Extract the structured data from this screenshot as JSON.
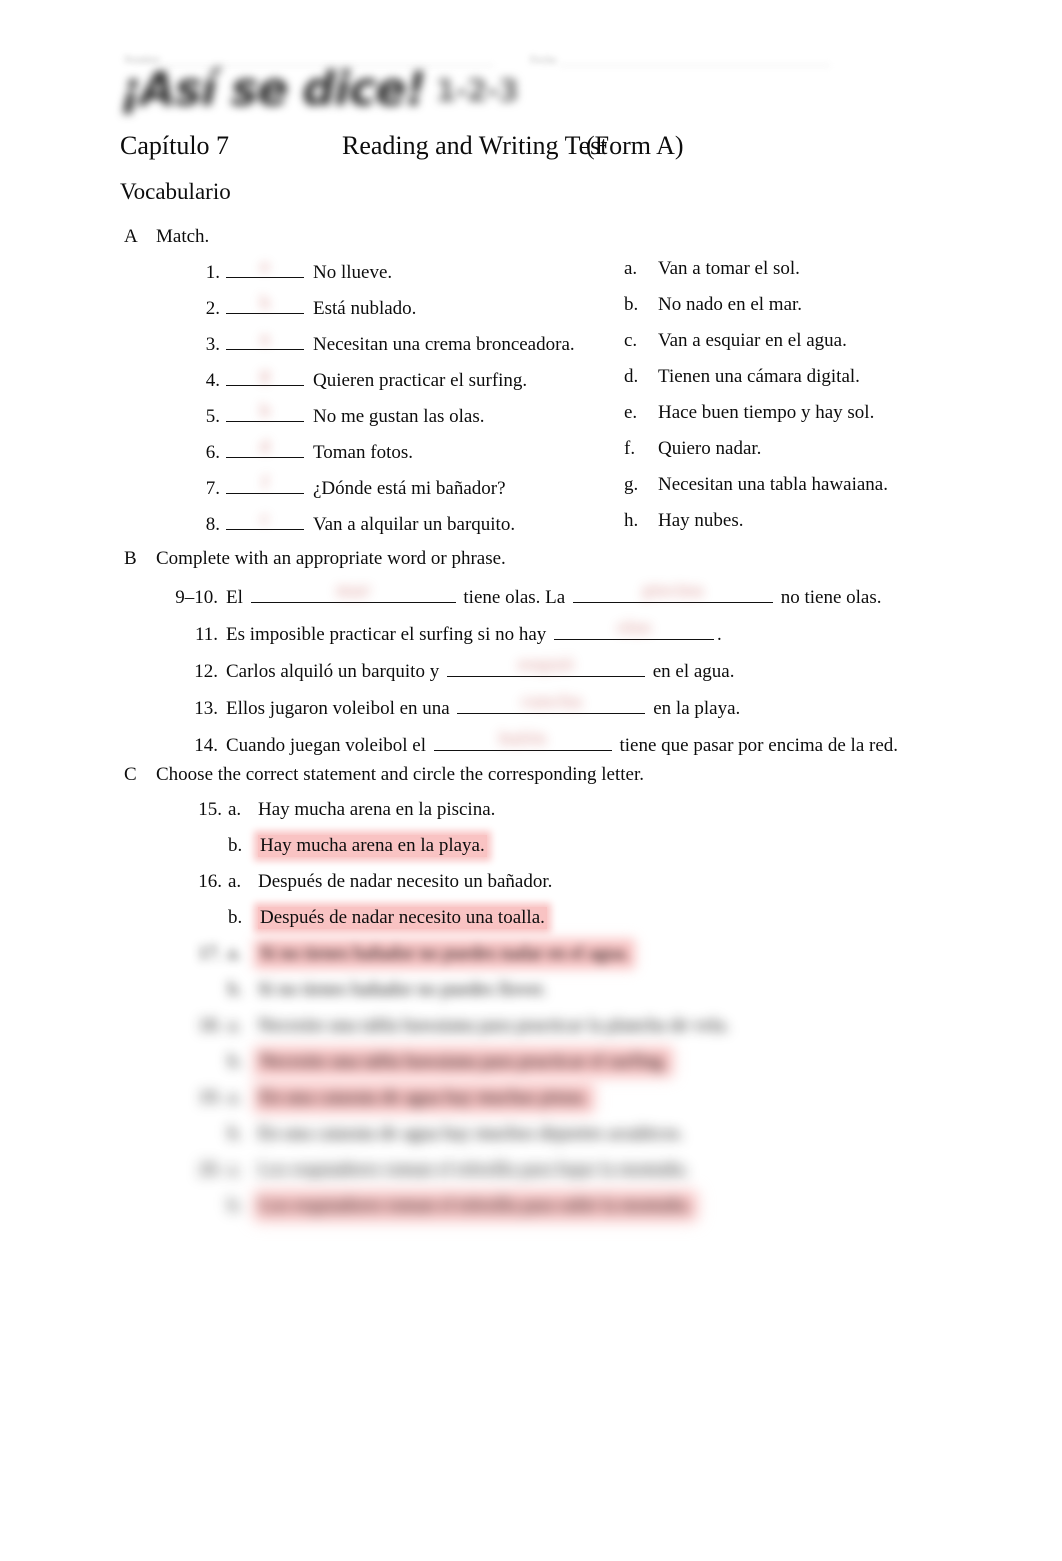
{
  "header": {
    "name_label": "Nombre",
    "date_label": "Fecha",
    "logo_text": "¡Así se dice!",
    "logo_level": "1-2-3"
  },
  "title": {
    "chapter": "Capítulo 7",
    "test_name": "Reading and Writing Test",
    "form": "(Form A)"
  },
  "section_heading": "Vocabulario",
  "sections": {
    "a": {
      "letter": "A",
      "directive": "Match.",
      "items": [
        {
          "num": "1.",
          "text": "No  llueve.",
          "answer": "e"
        },
        {
          "num": "2.",
          "text": "Está  nublado.",
          "answer": "h"
        },
        {
          "num": "3.",
          "text": "Necesitan una crema bronceadora.",
          "answer": "a"
        },
        {
          "num": "4.",
          "text": "Quieren practicar el surfing.",
          "answer": "g"
        },
        {
          "num": "5.",
          "text": "No me gustan las olas.",
          "answer": "b"
        },
        {
          "num": "6.",
          "text": "Toman  fotos.",
          "answer": "d"
        },
        {
          "num": "7.",
          "text": "¿Dónde está mi bañador?",
          "answer": "f"
        },
        {
          "num": "8.",
          "text": "Van a alquilar un barquito.",
          "answer": "c"
        }
      ],
      "options": [
        {
          "letter": "a.",
          "text": "Van a tomar el sol."
        },
        {
          "letter": "b.",
          "text": "No nado en el mar."
        },
        {
          "letter": "c.",
          "text": "Van a esquiar en el agua."
        },
        {
          "letter": "d.",
          "text": "Tienen una cámara digital."
        },
        {
          "letter": "e.",
          "text": "Hace buen tiempo y hay sol."
        },
        {
          "letter": "f.",
          "text": "Quiero nadar."
        },
        {
          "letter": "g.",
          "text": "Necesitan una tabla hawaiana."
        },
        {
          "letter": "h.",
          "text": "Hay nubes."
        }
      ]
    },
    "b": {
      "letter": "B",
      "directive": "Complete with an appropriate word or phrase.",
      "items": [
        {
          "num": "9–10.",
          "pre": "El",
          "answer1": "mar",
          "mid": "tiene olas. La",
          "answer2": "piscina",
          "post": "no tiene olas."
        },
        {
          "num": "11.",
          "pre": "Es imposible practicar el surfing si no hay",
          "answer1": "olas",
          "post": "."
        },
        {
          "num": "12.",
          "pre": "Carlos alquiló un barquito y",
          "answer1": "esquió",
          "post": "en el agua."
        },
        {
          "num": "13.",
          "pre": "Ellos jugaron voleibol en una",
          "answer1": "cancha",
          "post": "en la playa."
        },
        {
          "num": "14.",
          "pre": "Cuando juegan voleibol el",
          "answer1": "balón",
          "post": "tiene que pasar por encima de la red."
        }
      ]
    },
    "c": {
      "letter": "C",
      "directive": "Choose the correct statement and circle the corresponding letter.",
      "items": [
        {
          "num": "15.",
          "choices": [
            {
              "letter": "a.",
              "text": "Hay mucha arena en la piscina.",
              "highlight": false,
              "blur": 0
            },
            {
              "letter": "b.",
              "text": "Hay mucha arena en la playa.",
              "highlight": true,
              "blur": 0
            }
          ]
        },
        {
          "num": "16.",
          "choices": [
            {
              "letter": "a.",
              "text": "Después de nadar necesito un bañador.",
              "highlight": false,
              "blur": 0
            },
            {
              "letter": "b.",
              "text": "Después de nadar necesito una toalla.",
              "highlight": true,
              "blur": 0
            }
          ]
        },
        {
          "num": "17.",
          "choices": [
            {
              "letter": "a.",
              "text": "Si no tienes bañador no puedes nadar en el agua.",
              "highlight": true,
              "blur": 3
            },
            {
              "letter": "b.",
              "text": "Si no tienes bañador no puedes llover.",
              "highlight": false,
              "blur": 4
            }
          ]
        },
        {
          "num": "18.",
          "choices": [
            {
              "letter": "a.",
              "text": "Necesito una tabla hawaiana para practicar la plancha de vela.",
              "highlight": false,
              "blur": 5
            },
            {
              "letter": "b.",
              "text": "Necesito una tabla hawaiana para practicar el surfing.",
              "highlight": true,
              "blur": 5
            }
          ]
        },
        {
          "num": "19.",
          "choices": [
            {
              "letter": "a.",
              "text": "En una catarata de agua hay muchas pistas.",
              "highlight": true,
              "blur": 6
            },
            {
              "letter": "b.",
              "text": "En una catarata de agua hay muchos deportes acuáticos.",
              "highlight": false,
              "blur": 6
            }
          ]
        },
        {
          "num": "20.",
          "choices": [
            {
              "letter": "a.",
              "text": "Los esquiadores toman el telesilla para bajar la montaña.",
              "highlight": false,
              "blur": 7
            },
            {
              "letter": "b.",
              "text": "Los esquiadores toman el telesilla para subir la montaña.",
              "highlight": true,
              "blur": 7
            }
          ]
        }
      ]
    }
  },
  "colors": {
    "highlight": "#f9c3c3",
    "answer_ink": "#c0504d",
    "text": "#0d0d0d"
  }
}
